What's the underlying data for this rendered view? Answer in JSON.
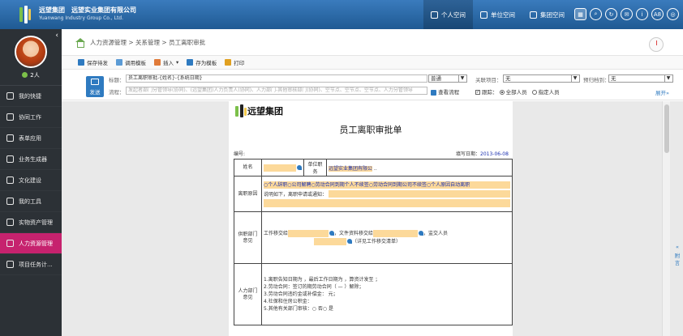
{
  "header": {
    "company_cn": "远望集团",
    "company_full": "远望实业集团有限公司",
    "company_en": "Yuanwang Industry Group Co., Ltd.",
    "nav": [
      {
        "label": "个人空间",
        "active": true,
        "icon": "person-icon"
      },
      {
        "label": "单位空间",
        "active": false,
        "icon": "bus-icon"
      },
      {
        "label": "集团空间",
        "active": false,
        "icon": "building-icon"
      }
    ],
    "icons": [
      "apps-icon",
      "search-icon",
      "refresh-icon",
      "message-icon",
      "info-icon",
      "text-size-icon",
      "settings-icon"
    ],
    "text_size_label": "A8"
  },
  "sidebar": {
    "online_count": "2人",
    "items": [
      {
        "label": "我的快捷",
        "icon": "plus-icon"
      },
      {
        "label": "协同工作",
        "icon": "flow-icon"
      },
      {
        "label": "表单应用",
        "icon": "table-icon"
      },
      {
        "label": "业务生成器",
        "icon": "home-icon"
      },
      {
        "label": "文化建设",
        "icon": "culture-icon"
      },
      {
        "label": "我的工具",
        "icon": "tools-icon"
      },
      {
        "label": "实物资产管理",
        "icon": "asset-icon"
      },
      {
        "label": "人力资源管理",
        "icon": "hr-icon",
        "active": true
      },
      {
        "label": "项目任务计...",
        "icon": "project-icon"
      }
    ]
  },
  "breadcrumb": "人力资源管理 > 关系管理 > 员工离职审批",
  "toolbar": {
    "save_draft": "保存待发",
    "template": "调用模板",
    "insert": "插入",
    "save_template": "存为模板",
    "print": "打印"
  },
  "formhead": {
    "send": "发送",
    "title_label": "标题：",
    "title_value": "员工离职审批-{姓名}-{系统日期}",
    "flow_label": "流程：",
    "flow_placeholder": "发起者部门分管领导(协同)、(远望集团)人力负责人(协同)、人力部门-其他审核部门(协同)、空节点、空节点、空节点、人力分管领导",
    "priority": "普通",
    "related_label": "关联项目：",
    "related_value": "无",
    "archive_label": "预归档到：",
    "archive_value": "无",
    "view_flow": "查看流程",
    "track_label": "跟踪：",
    "track_all": "全部人员",
    "track_specific": "指定人员",
    "expand": "展开"
  },
  "document": {
    "logo_text": "远望集团",
    "title": "员工离职审批单",
    "number_label": "编号:",
    "date_label": "填写日期：",
    "date_value": "2013-06-08",
    "name_label": "姓名",
    "dept_label": "单位职务",
    "dept_value": "远望实业集团有限公",
    "reason_label": "离职原因",
    "reason_options": "○个人辞职○公司解聘○劳动合同到期个人不续签○劳动合同到期公司不续签○个人原因自动离职",
    "reason_note": "说明如下，离职申请或通知：",
    "handover_label": "供职部门意见",
    "handover_work": "工作移交给",
    "handover_docs": "，文件资料移交给",
    "handover_supervisor": "，监交人员",
    "handover_note": "（详见工作移交清单）",
    "hr_label": "人力部门意见",
    "hr_lines": [
      "1.离职告知日期为 ，最后工作日期为 ，算资计发至 ；",
      "2.劳动合同：签订的期劳动合同（ — ）解除；",
      "3.劳动合同违约金或补偿金： 元；",
      "4.社保和住房公积金：",
      "5.其他有关部门审核：○ 否○ 是"
    ]
  },
  "right_tab": "附言"
}
